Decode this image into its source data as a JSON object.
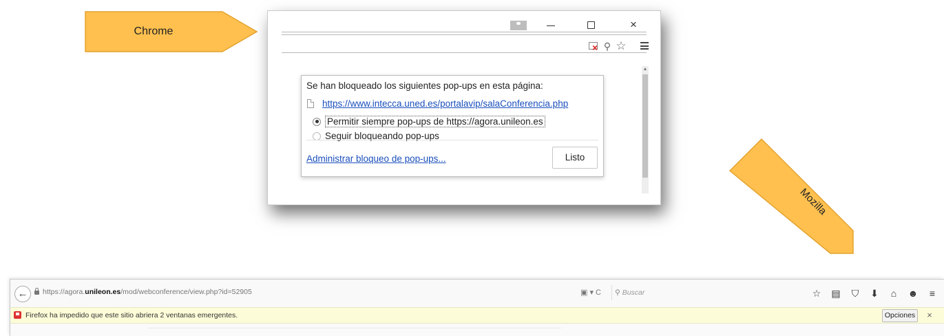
{
  "callouts": {
    "chrome": "Chrome",
    "mozilla": "Mozilla",
    "color_fill": "#FFC04F",
    "color_stroke": "#E3A32E"
  },
  "chrome": {
    "icons": {
      "user": "user-icon",
      "minimize": "minimize-icon",
      "maximize": "maximize-icon",
      "close_glyph": "×",
      "popup_blocked": "popup-blocked-icon",
      "zoom_glyph": "⚲",
      "star_glyph": "☆",
      "menu": "menu-icon"
    },
    "bubble": {
      "title": "Se han bloqueado los siguientes pop-ups en esta página:",
      "blocked_url": "https://www.intecca.uned.es/portalavip/salaConferencia.php",
      "option_allow": "Permitir siempre pop-ups de https://agora.unileon.es",
      "option_block": "Seguir bloqueando pop-ups",
      "selected_option": "allow",
      "manage_link": "Administrar bloqueo de pop-ups...",
      "done_button": "Listo"
    }
  },
  "firefox": {
    "back_glyph": "←",
    "url": {
      "prefix": "https://agora.",
      "domain": "unileon.es",
      "path": "/mod/webconference/view.php?id=52905"
    },
    "url_icons": "▣ ▾   C",
    "search_glyph": "⚲",
    "search_placeholder": "Buscar",
    "toolbar_icons": [
      "☆",
      "▤",
      "⛉",
      "⬇",
      "⌂",
      "☻",
      "≡"
    ],
    "toolbar_icon_names": [
      "bookmark-star-icon",
      "reading-list-icon",
      "pocket-icon",
      "downloads-icon",
      "home-icon",
      "chat-icon",
      "menu-icon"
    ],
    "notification": {
      "text": "Firefox ha impedido que este sitio abriera 2 ventanas emergentes.",
      "options_button": "Opciones",
      "close_glyph": "×"
    }
  }
}
